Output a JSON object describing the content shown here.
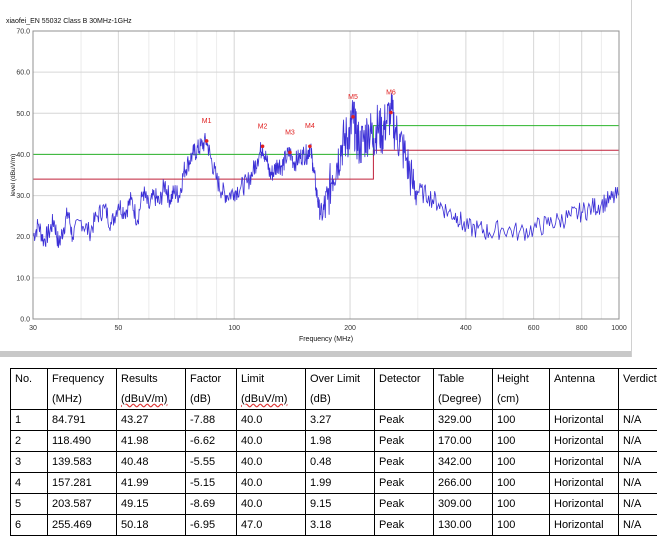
{
  "chart_data": {
    "type": "line",
    "title": "xiaofei_EN 55032 Class B 30MHz-1GHz",
    "xlabel": "Frequency (MHz)",
    "ylabel": "level (dBuV/m)",
    "x_scale": "log",
    "xlim": [
      30,
      1000
    ],
    "ylim": [
      0,
      70
    ],
    "x_ticks": [
      30,
      50,
      100,
      200,
      400,
      600,
      800,
      1000
    ],
    "y_ticks": [
      0,
      10,
      20,
      30,
      40,
      50,
      60,
      70
    ],
    "grid": true,
    "series": [
      {
        "color": "#3b2fd6",
        "x": [
          30,
          31,
          32,
          33,
          34,
          35,
          36,
          37,
          38,
          40,
          42,
          44,
          46,
          48,
          50,
          52,
          54,
          56,
          58,
          60,
          62,
          64,
          66,
          68,
          70,
          72,
          74,
          76,
          78,
          80,
          82,
          84.791,
          87,
          90,
          93,
          96,
          100,
          104,
          108,
          112,
          115,
          118.49,
          121,
          124,
          127,
          130,
          133,
          136,
          139.583,
          143,
          147,
          151,
          155,
          157.281,
          160,
          163,
          166,
          170,
          175,
          180,
          185,
          190,
          195,
          200,
          203.587,
          207,
          212,
          218,
          224,
          230,
          236,
          242,
          248,
          255.469,
          262,
          270,
          280,
          290,
          300,
          320,
          340,
          360,
          380,
          400,
          430,
          460,
          500,
          550,
          600,
          650,
          700,
          750,
          800,
          850,
          900,
          950,
          1000
        ],
        "y": [
          20,
          23,
          19,
          21,
          24,
          18,
          22,
          26,
          20,
          24,
          21,
          25,
          27,
          23,
          28,
          26,
          29,
          24,
          31,
          27,
          30,
          28,
          33,
          29,
          31,
          30,
          36,
          38,
          40,
          41,
          42,
          43.27,
          39,
          34,
          31,
          30,
          31,
          32,
          33,
          36,
          39,
          41.98,
          39,
          35,
          36,
          38,
          37,
          39,
          40.48,
          38,
          39,
          40,
          40,
          41.99,
          38,
          32,
          27,
          25,
          29,
          35,
          38,
          42,
          44,
          45,
          49.15,
          45,
          42,
          44,
          46,
          44,
          47,
          45,
          48,
          50.18,
          46,
          43,
          39,
          33,
          31,
          30,
          28,
          26,
          25,
          22,
          22,
          21,
          22,
          21,
          22,
          23,
          24,
          25,
          26,
          27,
          28,
          29,
          30
        ]
      }
    ],
    "limit_lines": [
      {
        "color": "#2db52d",
        "segments": [
          [
            30,
            40
          ],
          [
            230,
            40
          ],
          [
            230,
            47
          ],
          [
            1000,
            47
          ]
        ]
      },
      {
        "color": "#c0203a",
        "segments": [
          [
            30,
            34
          ],
          [
            230,
            34
          ],
          [
            230,
            41
          ],
          [
            1000,
            41
          ]
        ]
      }
    ],
    "markers": [
      {
        "label": "M1",
        "x": 84.791,
        "y": 43.27
      },
      {
        "label": "M2",
        "x": 118.49,
        "y": 41.98
      },
      {
        "label": "M3",
        "x": 139.583,
        "y": 40.48
      },
      {
        "label": "M4",
        "x": 157.281,
        "y": 41.99
      },
      {
        "label": "M5",
        "x": 203.587,
        "y": 49.15
      },
      {
        "label": "M6",
        "x": 255.469,
        "y": 50.18
      }
    ]
  },
  "table": {
    "headers": [
      [
        "No.",
        ""
      ],
      [
        "Frequency",
        "(MHz)"
      ],
      [
        "Results",
        "(dBuV/m)"
      ],
      [
        "Factor",
        "(dB)"
      ],
      [
        "Limit",
        "(dBuV/m)"
      ],
      [
        "Over Limit",
        "(dB)"
      ],
      [
        "Detector",
        ""
      ],
      [
        "Table",
        "(Degree)"
      ],
      [
        "Height",
        "(cm)"
      ],
      [
        "Antenna",
        ""
      ],
      [
        "Verdict",
        ""
      ]
    ],
    "rows": [
      [
        "1",
        "84.791",
        "43.27",
        "-7.88",
        "40.0",
        "3.27",
        "Peak",
        "329.00",
        "100",
        "Horizontal",
        "N/A"
      ],
      [
        "2",
        "118.490",
        "41.98",
        "-6.62",
        "40.0",
        "1.98",
        "Peak",
        "170.00",
        "100",
        "Horizontal",
        "N/A"
      ],
      [
        "3",
        "139.583",
        "40.48",
        "-5.55",
        "40.0",
        "0.48",
        "Peak",
        "342.00",
        "100",
        "Horizontal",
        "N/A"
      ],
      [
        "4",
        "157.281",
        "41.99",
        "-5.15",
        "40.0",
        "1.99",
        "Peak",
        "266.00",
        "100",
        "Horizontal",
        "N/A"
      ],
      [
        "5",
        "203.587",
        "49.15",
        "-8.69",
        "40.0",
        "9.15",
        "Peak",
        "309.00",
        "100",
        "Horizontal",
        "N/A"
      ],
      [
        "6",
        "255.469",
        "50.18",
        "-6.95",
        "47.0",
        "3.18",
        "Peak",
        "130.00",
        "100",
        "Horizontal",
        "N/A"
      ]
    ]
  }
}
